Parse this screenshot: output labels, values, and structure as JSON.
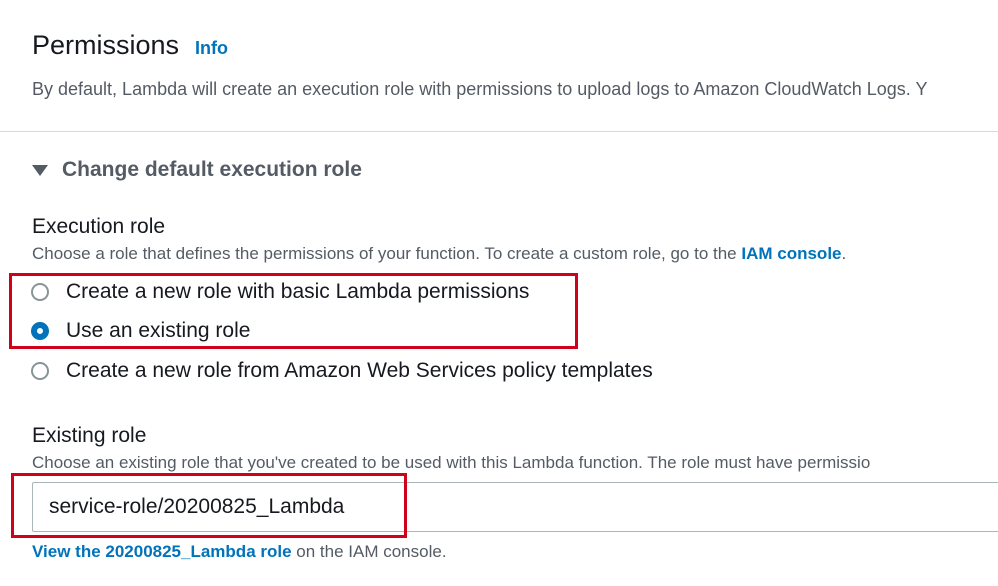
{
  "header": {
    "title": "Permissions",
    "info_link": "Info",
    "description": "By default, Lambda will create an execution role with permissions to upload logs to Amazon CloudWatch Logs. Y"
  },
  "expander": {
    "label": "Change default execution role",
    "expanded": true
  },
  "execution_role": {
    "label": "Execution role",
    "description_prefix": "Choose a role that defines the permissions of your function. To create a custom role, go to the ",
    "description_link": "IAM console",
    "description_suffix": ".",
    "options": [
      {
        "label": "Create a new role with basic Lambda permissions",
        "selected": false
      },
      {
        "label": "Use an existing role",
        "selected": true
      },
      {
        "label": "Create a new role from Amazon Web Services policy templates",
        "selected": false
      }
    ]
  },
  "existing_role": {
    "label": "Existing role",
    "description": "Choose an existing role that you've created to be used with this Lambda function. The role must have permissio",
    "value": "service-role/20200825_Lambda",
    "footnote_link": "View the 20200825_Lambda role",
    "footnote_suffix": " on the IAM console."
  },
  "colors": {
    "accent": "#0073bb",
    "annotation": "#d0021b",
    "text_primary": "#16191f",
    "text_secondary": "#545b64"
  }
}
